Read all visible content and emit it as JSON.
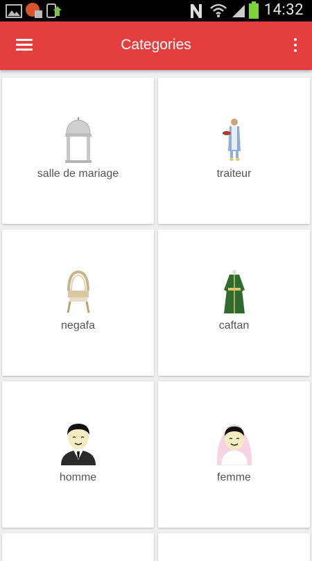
{
  "status_bar": {
    "time": "14:32",
    "icons": [
      "gallery-icon",
      "notification-app-icon",
      "phone-upload-icon",
      "n-icon",
      "wifi-icon",
      "signal-icon",
      "battery-icon"
    ]
  },
  "app_bar": {
    "title": "Categories",
    "background_color": "#e53e3e",
    "menu_icon": "hamburger-menu-icon",
    "overflow_icon": "more-vert-icon"
  },
  "categories": [
    {
      "label": "salle de mariage",
      "icon": "wedding-hall-icon"
    },
    {
      "label": "traiteur",
      "icon": "caterer-icon"
    },
    {
      "label": "negafa",
      "icon": "negafa-chair-icon"
    },
    {
      "label": "caftan",
      "icon": "caftan-dress-icon"
    },
    {
      "label": "homme",
      "icon": "groom-icon"
    },
    {
      "label": "femme",
      "icon": "bride-icon"
    }
  ]
}
